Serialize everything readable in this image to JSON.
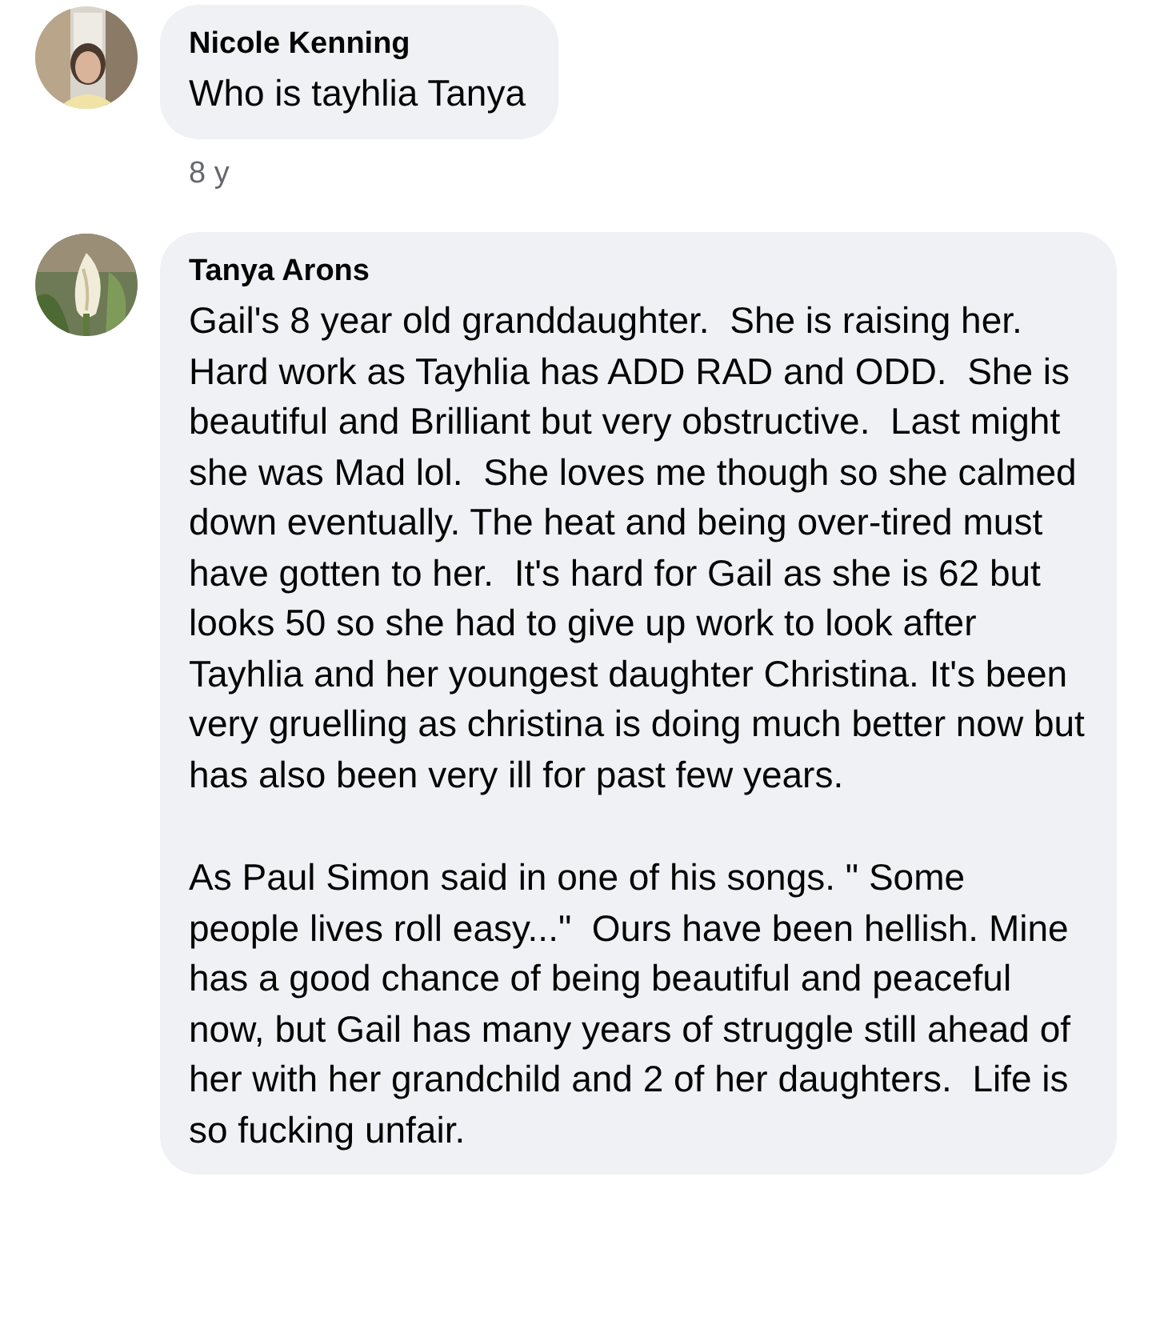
{
  "comments": [
    {
      "author": "Nicole Kenning",
      "avatar": {
        "kind": "picture"
      },
      "paragraphs": [
        "Who is tayhlia Tanya"
      ],
      "time": "8 y"
    },
    {
      "author": "Tanya Arons",
      "avatar": {
        "kind": "picture"
      },
      "paragraphs": [
        "Gail's 8 year old granddaughter.  She is raising her.  Hard work as Tayhlia has ADD RAD and ODD.  She is beautiful and Brilliant but very obstructive.  Last might she was Mad lol.  She loves me though so she calmed down eventually. The heat and being over-tired must have gotten to her.  It's hard for Gail as she is 62 but looks 50 so she had to give up work to look after Tayhlia and her youngest daughter Christina. It's been very gruelling as christina is doing much better now but has also been very ill for past few years.",
        "As Paul Simon said in one of his songs. \" Some people lives roll easy...\"  Ours have been hellish. Mine has a good chance of being beautiful and peaceful now, but Gail has many years of struggle still ahead of her with her grandchild and 2 of her daughters.  Life is so fucking unfair."
      ]
    }
  ]
}
